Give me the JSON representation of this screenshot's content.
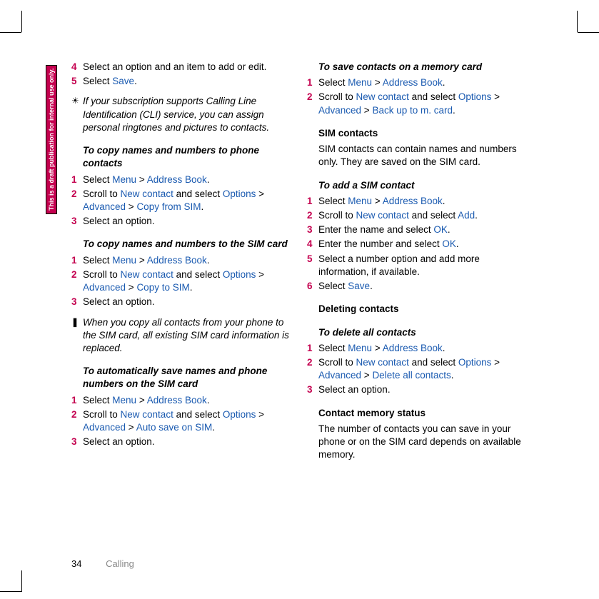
{
  "sideLabel": "This is a draft publication for internal use only.",
  "footer": {
    "page": "34",
    "section": "Calling"
  },
  "leftCol": {
    "s4": {
      "n": "4",
      "t1": "Select an option and an item to add or edit."
    },
    "s5": {
      "n": "5",
      "t1": "Select ",
      "link": "Save",
      "t2": "."
    },
    "note1": "If your subscription supports Calling Line Identification (CLI) service, you can assign personal ringtones and pictures to contacts.",
    "h1": "To copy names and numbers to phone contacts",
    "a1": {
      "n": "1",
      "pre": "Select ",
      "l1": "Menu",
      "sep": " > ",
      "l2": "Address Book",
      "post": "."
    },
    "a2": {
      "n": "2",
      "pre": "Scroll to ",
      "l1": "New contact",
      "mid": " and select ",
      "l2": "Options",
      "sep1": " > ",
      "l3": "Advanced",
      "sep2": " > ",
      "l4": "Copy from SIM",
      "post": "."
    },
    "a3": {
      "n": "3",
      "t": "Select an option."
    },
    "h2": "To copy names and numbers to the SIM card",
    "b1": {
      "n": "1",
      "pre": "Select ",
      "l1": "Menu",
      "sep": " > ",
      "l2": "Address Book",
      "post": "."
    },
    "b2": {
      "n": "2",
      "pre": "Scroll to ",
      "l1": "New contact",
      "mid": " and select ",
      "l2": "Options",
      "sep1": " > ",
      "l3": "Advanced",
      "sep2": " > ",
      "l4": "Copy to SIM",
      "post": "."
    },
    "b3": {
      "n": "3",
      "t": "Select an option."
    },
    "note2": "When you copy all contacts from your phone to the SIM card, all existing SIM card information is replaced.",
    "h3": "To automatically save names and phone numbers on the SIM card",
    "c1": {
      "n": "1",
      "pre": "Select ",
      "l1": "Menu",
      "sep": " > ",
      "l2": "Address Book",
      "post": "."
    },
    "c2": {
      "n": "2",
      "pre": "Scroll to ",
      "l1": "New contact",
      "mid": " and select ",
      "l2": "Options",
      "sep1": " > ",
      "l3": "Advanced",
      "sep2": " > ",
      "l4": "Auto save on SIM",
      "post": "."
    },
    "c3": {
      "n": "3",
      "t": "Select an option."
    }
  },
  "rightCol": {
    "h1": "To save contacts on a memory card",
    "d1": {
      "n": "1",
      "pre": "Select ",
      "l1": "Menu",
      "sep": " > ",
      "l2": "Address Book",
      "post": "."
    },
    "d2": {
      "n": "2",
      "pre": "Scroll to ",
      "l1": "New contact",
      "mid": " and select ",
      "l2": "Options",
      "sep1": " > ",
      "l3": "Advanced",
      "sep2": " > ",
      "l4": "Back up to m. card",
      "post": "."
    },
    "sh1": "SIM contacts",
    "p1": "SIM contacts can contain names and numbers only. They are saved on the SIM card.",
    "h2": "To add a SIM contact",
    "e1": {
      "n": "1",
      "pre": "Select ",
      "l1": "Menu",
      "sep": " > ",
      "l2": "Address Book",
      "post": "."
    },
    "e2": {
      "n": "2",
      "pre": "Scroll to ",
      "l1": "New contact",
      "mid": " and select ",
      "l2": "Add",
      "post": "."
    },
    "e3": {
      "n": "3",
      "pre": "Enter the name and select ",
      "l1": "OK",
      "post": "."
    },
    "e4": {
      "n": "4",
      "pre": "Enter the number and select ",
      "l1": "OK",
      "post": "."
    },
    "e5": {
      "n": "5",
      "t": "Select a number option and add more information, if available."
    },
    "e6": {
      "n": "6",
      "pre": "Select ",
      "l1": "Save",
      "post": "."
    },
    "sh2": "Deleting contacts",
    "h3": "To delete all contacts",
    "f1": {
      "n": "1",
      "pre": "Select ",
      "l1": "Menu",
      "sep": " > ",
      "l2": "Address Book",
      "post": "."
    },
    "f2": {
      "n": "2",
      "pre": "Scroll to ",
      "l1": "New contact",
      "mid": " and select ",
      "l2": "Options",
      "sep1": " > ",
      "l3": "Advanced",
      "sep2": " > ",
      "l4": "Delete all contacts",
      "post": "."
    },
    "f3": {
      "n": "3",
      "t": "Select an option."
    },
    "sh3": "Contact memory status",
    "p2": "The number of contacts you can save in your phone or on the SIM card depends on available memory."
  }
}
